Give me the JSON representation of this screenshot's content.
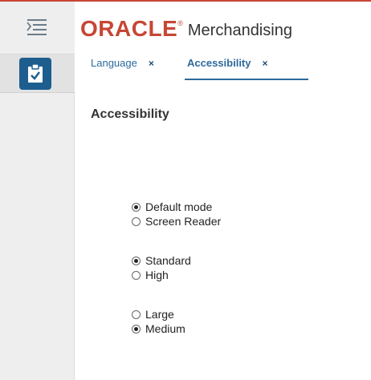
{
  "brand": {
    "logo": "ORACLE",
    "registered": "®",
    "product": "Merchandising",
    "accent": "#c74634"
  },
  "nav": {
    "menu_icon": "hamburger-menu-icon",
    "task_icon": "clipboard-check-icon",
    "task_color": "#1d5e8f"
  },
  "tabs": [
    {
      "label": "Language",
      "close": "×",
      "active": false
    },
    {
      "label": "Accessibility",
      "close": "×",
      "active": true
    }
  ],
  "page": {
    "title": "Accessibility"
  },
  "options": {
    "mode": [
      {
        "label": "Default mode",
        "selected": true
      },
      {
        "label": "Screen Reader",
        "selected": false
      }
    ],
    "contrast": [
      {
        "label": "Standard",
        "selected": true
      },
      {
        "label": "High",
        "selected": false
      }
    ],
    "font_size": [
      {
        "label": "Large",
        "selected": false
      },
      {
        "label": "Medium",
        "selected": true
      }
    ]
  }
}
